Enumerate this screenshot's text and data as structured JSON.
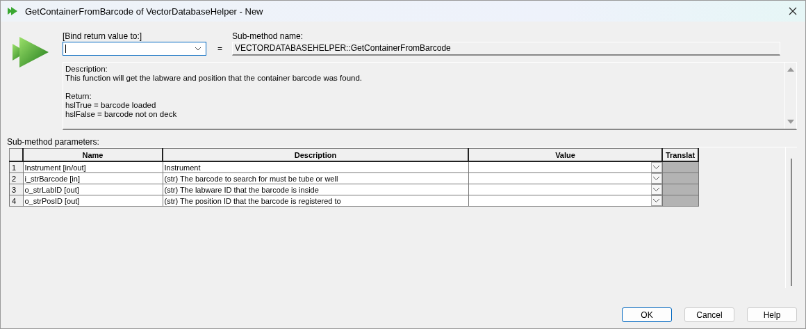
{
  "window": {
    "title": "GetContainerFromBarcode of VectorDatabaseHelper - New"
  },
  "bind": {
    "label": "[Bind return value to:]",
    "focused": true,
    "equals": "="
  },
  "submethod": {
    "label": "Sub-method name:",
    "value": "VECTORDATABASEHELPER::GetContainerFromBarcode"
  },
  "description": {
    "paragraphs": [
      [
        "Description:",
        "This function will get the labware and position that the container barcode was found."
      ],
      [
        "Return:",
        "hslTrue =  barcode loaded",
        "hslFalse = barcode not on deck"
      ]
    ]
  },
  "parameters": {
    "label": "Sub-method parameters:",
    "columns": [
      "Name",
      "Description",
      "Value",
      "Translat"
    ],
    "rows": [
      {
        "number": "1",
        "name": "Instrument [in/out]",
        "description": "Instrument",
        "translate_disabled": true
      },
      {
        "number": "2",
        "name": "i_strBarcode [in]",
        "description": "(str) The barcode to search for must be tube or well",
        "translate_disabled": true
      },
      {
        "number": "3",
        "name": "o_strLabID [out]",
        "description": "(str) The labware ID that the barcode is inside",
        "translate_disabled": true
      },
      {
        "number": "4",
        "name": "o_strPosID [out]",
        "description": "(str) The position ID that the barcode is registered to",
        "translate_disabled": true
      }
    ]
  },
  "buttons": [
    {
      "label": "OK",
      "default": true
    },
    {
      "label": "Cancel",
      "default": false
    },
    {
      "label": "Help",
      "default": false
    }
  ]
}
